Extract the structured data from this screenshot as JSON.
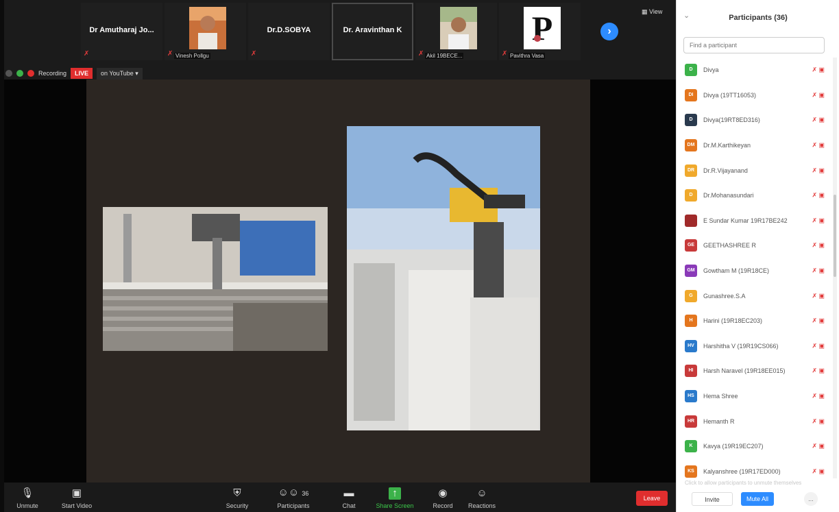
{
  "strip": {
    "tiles": [
      {
        "name": "Dr Amutharaj Jo...",
        "label": ""
      },
      {
        "name": "",
        "label": "Vinesh Pollgu"
      },
      {
        "name": "Dr.D.SOBYA",
        "label": ""
      },
      {
        "name": "Dr. Aravinthan K",
        "label": ""
      },
      {
        "name": "",
        "label": "Akil 19BECE..."
      },
      {
        "name": "",
        "label": "Pavithra Vasa"
      }
    ],
    "view_label": "View"
  },
  "status": {
    "recording_label": "Recording",
    "live_label": "LIVE",
    "youtube_label": "on YouTube"
  },
  "toolbar": {
    "unmute": "Unmute",
    "start_video": "Start Video",
    "security": "Security",
    "participants": "Participants",
    "participants_count": "36",
    "chat": "Chat",
    "share_screen": "Share Screen",
    "record": "Record",
    "reactions": "Reactions",
    "leave": "Leave"
  },
  "panel": {
    "title": "Participants (36)",
    "search_placeholder": "Find a participant",
    "participants": [
      {
        "initials": "D",
        "name": "Divya",
        "color": "#3cb24a"
      },
      {
        "initials": "DI",
        "name": "Divya (19TT16053)",
        "color": "#e4761e"
      },
      {
        "initials": "D",
        "name": "Divya(19RT8ED316)",
        "color": "#2a3a4e"
      },
      {
        "initials": "DM",
        "name": "Dr.M.Karthikeyan",
        "color": "#e4761e"
      },
      {
        "initials": "DR",
        "name": "Dr.R.Vijayanand",
        "color": "#f0a92c"
      },
      {
        "initials": "D",
        "name": "Dr.Mohanasundari",
        "color": "#f0a92c"
      },
      {
        "initials": "",
        "name": "E Sundar Kumar 19R17BE242",
        "color": "#a02a2a"
      },
      {
        "initials": "GE",
        "name": "GEETHASHREE R",
        "color": "#c83a3a"
      },
      {
        "initials": "GM",
        "name": "Gowtham M (19R18CE)",
        "color": "#8a3ab8"
      },
      {
        "initials": "G",
        "name": "Gunashree.S.A",
        "color": "#f0a92c"
      },
      {
        "initials": "H",
        "name": "Harini (19R18EC203)",
        "color": "#e4761e"
      },
      {
        "initials": "HV",
        "name": "Harshitha V (19R19CS066)",
        "color": "#2a7acb"
      },
      {
        "initials": "HI",
        "name": "Harsh Naravel (19R18EE015)",
        "color": "#c83a3a"
      },
      {
        "initials": "HS",
        "name": "Hema Shree",
        "color": "#2a7acb"
      },
      {
        "initials": "HR",
        "name": "Hemanth R",
        "color": "#c83a3a"
      },
      {
        "initials": "K",
        "name": "Kavya (19R19EC207)",
        "color": "#3cb24a"
      },
      {
        "initials": "KS",
        "name": "Kalyanshree (19R17ED000)",
        "color": "#e4761e"
      }
    ],
    "footer_hint": "Click to allow participants to unmute themselves",
    "invite": "Invite",
    "mute_all": "Mute All",
    "more": "..."
  }
}
